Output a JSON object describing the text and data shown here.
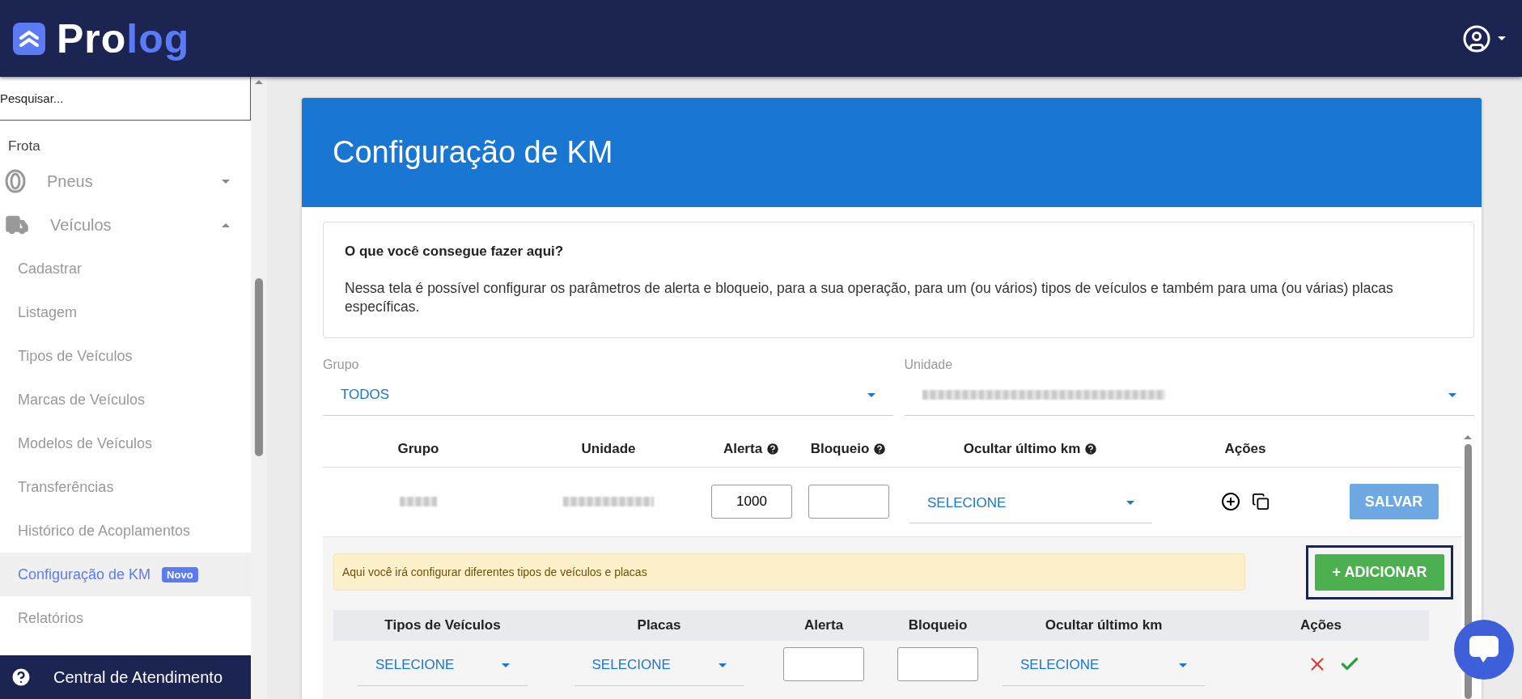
{
  "header": {
    "logo": {
      "first": "Pro",
      "second": "log"
    }
  },
  "sidebar": {
    "search": {
      "placeholder": "Pesquisar..."
    },
    "section": "Frota",
    "menus": [
      {
        "label": "Pneus",
        "kind": "tire",
        "expanded": false
      },
      {
        "label": "Veículos",
        "kind": "truck",
        "expanded": true,
        "children": [
          {
            "label": "Cadastrar",
            "selected": false
          },
          {
            "label": "Listagem",
            "selected": false
          },
          {
            "label": "Tipos de Veículos",
            "selected": false
          },
          {
            "label": "Marcas de Veículos",
            "selected": false
          },
          {
            "label": "Modelos de Veículos",
            "selected": false
          },
          {
            "label": "Transferências",
            "selected": false
          },
          {
            "label": "Histórico de Acoplamentos",
            "selected": false
          },
          {
            "label": "Configuração de KM",
            "selected": true,
            "badge": "Novo"
          },
          {
            "label": "Relatórios",
            "selected": false
          }
        ]
      }
    ],
    "help": "Central de Atendimento"
  },
  "page": {
    "title": "Configuração de KM",
    "info": {
      "heading": "O que você consegue fazer aqui?",
      "text": "Nessa tela é possível configurar os parâmetros de alerta e bloqueio, para a sua operação, para um (ou vários) tipos de veículos e também para uma (ou várias) placas específicas."
    },
    "filters": [
      {
        "label": "Grupo",
        "value": "TODOS"
      },
      {
        "label": "Unidade"
      }
    ],
    "table": {
      "columns": [
        {
          "label": "Grupo",
          "help": false
        },
        {
          "label": "Unidade",
          "help": false
        },
        {
          "label": "Alerta",
          "help": true
        },
        {
          "label": "Bloqueio",
          "help": true
        },
        {
          "label": "Ocultar último km",
          "help": true
        },
        {
          "label": "Ações",
          "help": false
        }
      ],
      "rows": [
        {
          "alerta": "1000",
          "ocultar": "SELECIONE",
          "save": "SALVAR"
        }
      ]
    },
    "subpanel": {
      "notice": "Aqui você irá configurar diferentes tipos de veículos e placas",
      "add_button": "+ ADICIONAR",
      "columns": [
        "Tipos de Veículos",
        "Placas",
        "Alerta",
        "Bloqueio",
        "Ocultar último km",
        "Ações"
      ],
      "rows": [
        {
          "tipos": "SELECIONE",
          "placas": "SELECIONE",
          "ocultar": "SELECIONE"
        }
      ]
    }
  }
}
